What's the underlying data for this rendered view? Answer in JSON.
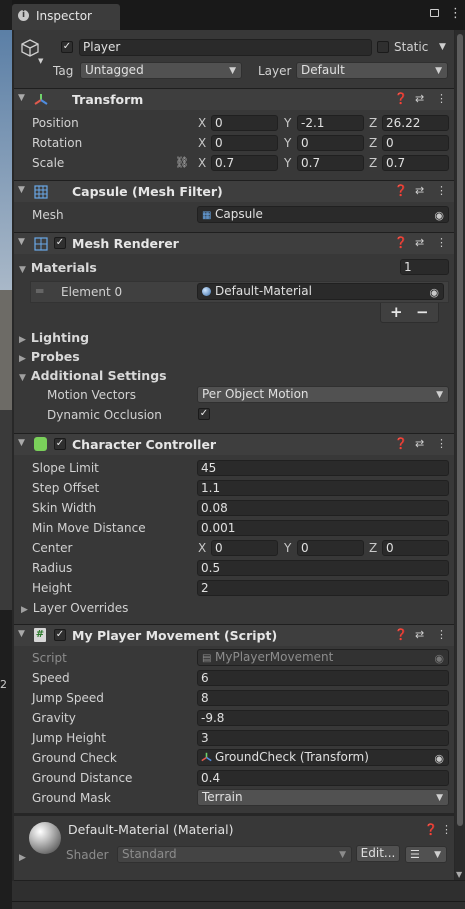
{
  "tab": {
    "title": "Inspector"
  },
  "gameobject": {
    "name": "Player",
    "static_label": "Static",
    "tag_label": "Tag",
    "tag_value": "Untagged",
    "layer_label": "Layer",
    "layer_value": "Default"
  },
  "transform": {
    "title": "Transform",
    "position_label": "Position",
    "rotation_label": "Rotation",
    "scale_label": "Scale",
    "position": {
      "x": "0",
      "y": "-2.1",
      "z": "26.22"
    },
    "rotation": {
      "x": "0",
      "y": "0",
      "z": "0"
    },
    "scale": {
      "x": "0.7",
      "y": "0.7",
      "z": "0.7"
    }
  },
  "axes": {
    "x": "X",
    "y": "Y",
    "z": "Z"
  },
  "mesh_filter": {
    "title": "Capsule (Mesh Filter)",
    "mesh_label": "Mesh",
    "mesh_value": "Capsule"
  },
  "mesh_renderer": {
    "title": "Mesh Renderer",
    "materials_label": "Materials",
    "materials_count": "1",
    "element_label": "Element 0",
    "element_value": "Default-Material",
    "plus": "+",
    "minus": "−",
    "lighting": "Lighting",
    "probes": "Probes",
    "additional": "Additional Settings",
    "motion_vectors_label": "Motion Vectors",
    "motion_vectors_value": "Per Object Motion",
    "dynamic_occlusion_label": "Dynamic Occlusion"
  },
  "character_controller": {
    "title": "Character Controller",
    "slope_limit_label": "Slope Limit",
    "slope_limit": "45",
    "step_offset_label": "Step Offset",
    "step_offset": "1.1",
    "skin_width_label": "Skin Width",
    "skin_width": "0.08",
    "min_move_label": "Min Move Distance",
    "min_move": "0.001",
    "center_label": "Center",
    "center": {
      "x": "0",
      "y": "0",
      "z": "0"
    },
    "radius_label": "Radius",
    "radius": "0.5",
    "height_label": "Height",
    "height": "2",
    "layer_overrides": "Layer Overrides"
  },
  "script": {
    "title": "My Player Movement (Script)",
    "script_label": "Script",
    "script_value": "MyPlayerMovement",
    "speed_label": "Speed",
    "speed": "6",
    "jump_speed_label": "Jump Speed",
    "jump_speed": "8",
    "gravity_label": "Gravity",
    "gravity": "-9.8",
    "jump_height_label": "Jump Height",
    "jump_height": "3",
    "ground_check_label": "Ground Check",
    "ground_check": "GroundCheck (Transform)",
    "ground_distance_label": "Ground Distance",
    "ground_distance": "0.4",
    "ground_mask_label": "Ground Mask",
    "ground_mask": "Terrain"
  },
  "material": {
    "title": "Default-Material (Material)",
    "shader_label": "Shader",
    "shader_value": "Standard",
    "edit_label": "Edit..."
  },
  "side": {
    "num": "2"
  }
}
